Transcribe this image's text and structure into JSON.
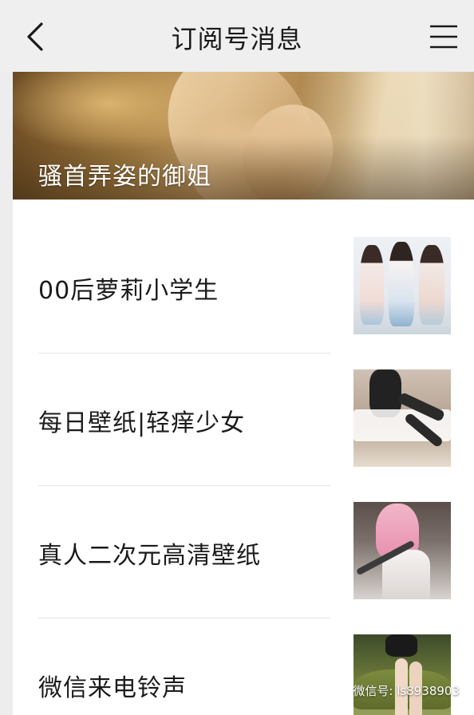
{
  "header": {
    "title": "订阅号消息",
    "back_icon": "chevron-left-icon",
    "menu_icon": "hamburger-menu-icon"
  },
  "banner": {
    "title": "骚首弄姿的御姐"
  },
  "articles": [
    {
      "title": "00后萝莉小学生",
      "thumbnail": "three-girls-thumbnail"
    },
    {
      "title": "每日壁纸|轻痒少女",
      "thumbnail": "stockings-thumbnail"
    },
    {
      "title": "真人二次元高清壁纸",
      "thumbnail": "pink-hair-cosplay-thumbnail"
    },
    {
      "title": "微信来电铃声",
      "thumbnail": "car-model-thumbnail"
    }
  ],
  "watermark": {
    "text": "微信号: ls8938903"
  },
  "colors": {
    "header_bg": "#efefef",
    "card_bg": "#ffffff",
    "page_bg": "#ededed",
    "text": "#1b1b1b",
    "divider": "#e3e3e3"
  }
}
